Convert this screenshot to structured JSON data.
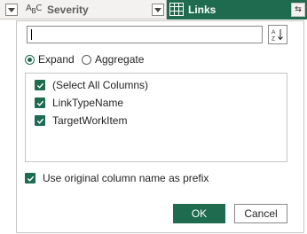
{
  "header": {
    "severity_type_icon": "abc-text-type-icon",
    "severity_label": "Severity",
    "links_type_icon": "table-icon",
    "links_label": "Links",
    "expand_icon": "expand-arrows-icon"
  },
  "panel": {
    "search": {
      "value": "",
      "placeholder": ""
    },
    "sort_icon": "sort-az-icon",
    "modes": [
      {
        "label": "Expand",
        "selected": true
      },
      {
        "label": "Aggregate",
        "selected": false
      }
    ],
    "columns": [
      {
        "label": "(Select All Columns)",
        "checked": true
      },
      {
        "label": "LinkTypeName",
        "checked": true
      },
      {
        "label": "TargetWorkItem",
        "checked": true
      }
    ],
    "prefix": {
      "label": "Use original column name as prefix",
      "checked": true
    },
    "ok_label": "OK",
    "cancel_label": "Cancel"
  },
  "colors": {
    "accent": "#1e6b4f",
    "header_bg": "#f3f2f1",
    "border": "#c8c6c4"
  }
}
